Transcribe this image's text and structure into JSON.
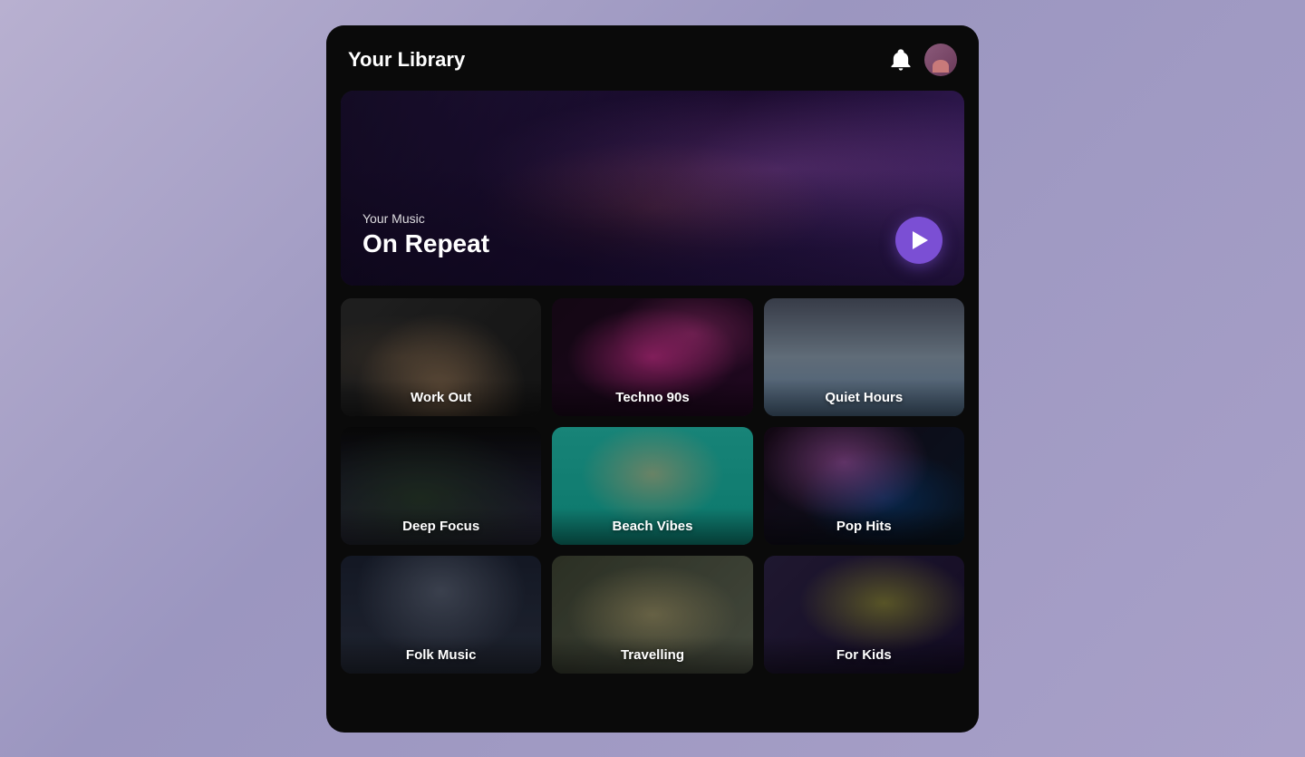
{
  "header": {
    "title": "Your Library",
    "bell_label": "notifications",
    "avatar_label": "user avatar"
  },
  "hero": {
    "subtitle": "Your Music",
    "title": "On Repeat",
    "play_label": "Play"
  },
  "playlists": [
    {
      "id": "workout",
      "label": "Work Out",
      "bg_class": "bg-workout"
    },
    {
      "id": "techno90s",
      "label": "Techno 90s",
      "bg_class": "bg-techno"
    },
    {
      "id": "quiet",
      "label": "Quiet Hours",
      "bg_class": "bg-quiet"
    },
    {
      "id": "deepfocus",
      "label": "Deep Focus",
      "bg_class": "bg-deepfocus"
    },
    {
      "id": "beach",
      "label": "Beach Vibes",
      "bg_class": "bg-beach"
    },
    {
      "id": "pophits",
      "label": "Pop Hits",
      "bg_class": "bg-pophits"
    },
    {
      "id": "folk",
      "label": "Folk Music",
      "bg_class": "bg-folk"
    },
    {
      "id": "travelling",
      "label": "Travelling",
      "bg_class": "bg-travelling"
    },
    {
      "id": "forkids",
      "label": "For Kids",
      "bg_class": "bg-forkids"
    }
  ]
}
